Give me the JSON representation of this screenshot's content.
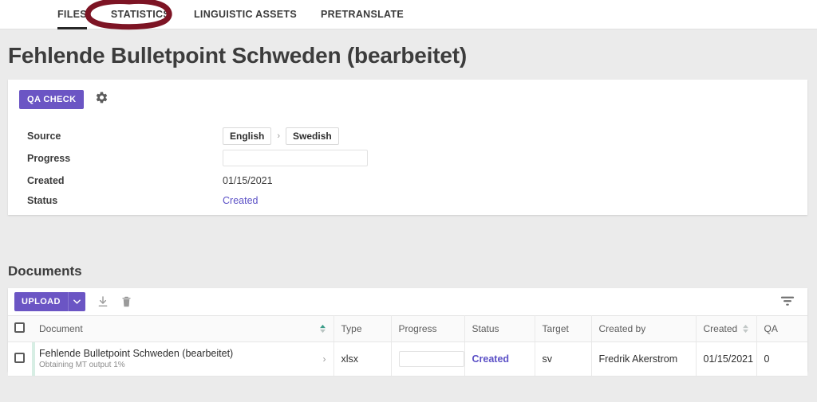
{
  "tabs": [
    {
      "label": "FILES",
      "active": true
    },
    {
      "label": "STATISTICS",
      "active": false
    },
    {
      "label": "LINGUISTIC ASSETS",
      "active": false
    },
    {
      "label": "PRETRANSLATE",
      "active": false
    }
  ],
  "page": {
    "title": "Fehlende Bulletpoint Schweden (bearbeitet)"
  },
  "card": {
    "qa_check_label": "QA CHECK",
    "settings_icon": "gear-icon",
    "rows": [
      {
        "label": "Source",
        "type": "languages",
        "from": "English",
        "separator": "›",
        "to": "Swedish"
      },
      {
        "label": "Progress",
        "type": "progress",
        "value": ""
      },
      {
        "label": "Created",
        "type": "text",
        "value": "01/15/2021"
      },
      {
        "label": "Status",
        "type": "link",
        "value": "Created"
      }
    ]
  },
  "documents": {
    "section_title": "Documents",
    "toolbar": {
      "upload_label": "UPLOAD",
      "upload_caret_icon": "chevron-down-icon",
      "download_icon": "download-icon",
      "delete_icon": "trash-icon",
      "filter_icon": "filter-icon"
    },
    "columns": [
      {
        "key": "checkbox",
        "label": "",
        "sortable": false
      },
      {
        "key": "document",
        "label": "Document",
        "sortable": true
      },
      {
        "key": "type",
        "label": "Type",
        "sortable": false
      },
      {
        "key": "progress",
        "label": "Progress",
        "sortable": false
      },
      {
        "key": "status",
        "label": "Status",
        "sortable": false
      },
      {
        "key": "target",
        "label": "Target",
        "sortable": false
      },
      {
        "key": "created_by",
        "label": "Created by",
        "sortable": false
      },
      {
        "key": "created",
        "label": "Created",
        "sortable": true
      },
      {
        "key": "qa",
        "label": "QA",
        "sortable": false
      }
    ],
    "rows": [
      {
        "document": "Fehlende Bulletpoint Schweden (bearbeitet)",
        "subtitle": "Obtaining MT output 1%",
        "type": "xlsx",
        "progress": "",
        "status": "Created",
        "target": "sv",
        "created_by": "Fredrik Akerstrom",
        "created": "01/15/2021",
        "qa": "0"
      }
    ]
  },
  "annotation": {
    "shape": "hand-drawn-ellipse",
    "target_tab": "STATISTICS",
    "color": "#7d1424"
  },
  "colors": {
    "accent_purple": "#6b55c4",
    "link_purple": "#5b50c6",
    "page_background": "#ebebeb",
    "card_background": "#ffffff",
    "annotation_red": "#7d1424"
  }
}
